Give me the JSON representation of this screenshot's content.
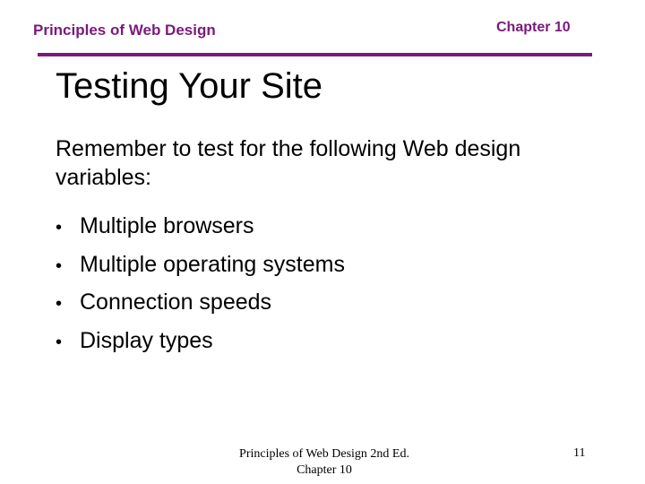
{
  "header": {
    "course": "Principles of Web Design",
    "chapter": "Chapter 10",
    "accent_color": "#7a1a7a"
  },
  "slide": {
    "title": "Testing Your Site",
    "intro": "Remember to test for the following Web design variables:",
    "bullet_glyph": "•",
    "bullets": [
      "Multiple browsers",
      "Multiple operating systems",
      "Connection speeds",
      "Display types"
    ]
  },
  "footer": {
    "line1": "Principles of Web Design 2nd Ed.",
    "line2": "Chapter 10",
    "page_number": "11"
  }
}
